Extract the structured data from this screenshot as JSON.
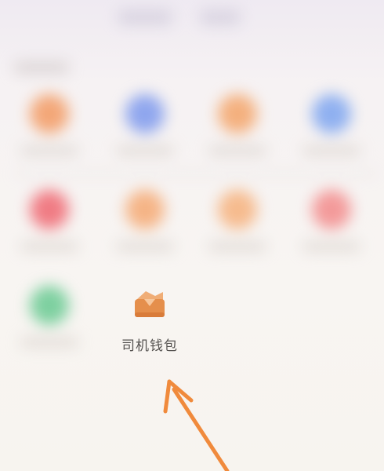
{
  "grid": {
    "items": [
      {
        "icon": "orange-circle-icon",
        "color": "#f3a778"
      },
      {
        "icon": "blue-circle-icon",
        "color": "#8fa6ee"
      },
      {
        "icon": "orange-circle-icon",
        "color": "#f4b07e"
      },
      {
        "icon": "blue-circle-icon",
        "color": "#8fb0f0"
      },
      {
        "icon": "red-circle-icon",
        "color": "#f07c84"
      },
      {
        "icon": "orange-circle-icon",
        "color": "#f5b486"
      },
      {
        "icon": "orange-circle-icon",
        "color": "#f6bb8e"
      },
      {
        "icon": "red-circle-icon",
        "color": "#f39a9a"
      },
      {
        "icon": "green-circle-icon",
        "color": "#7ed0a0"
      }
    ]
  },
  "wallet": {
    "label": "司机钱包",
    "icon": "wallet-icon",
    "icon_color": "#e58f4c"
  },
  "annotation": {
    "icon": "arrow-icon",
    "color": "#f08a3c"
  }
}
